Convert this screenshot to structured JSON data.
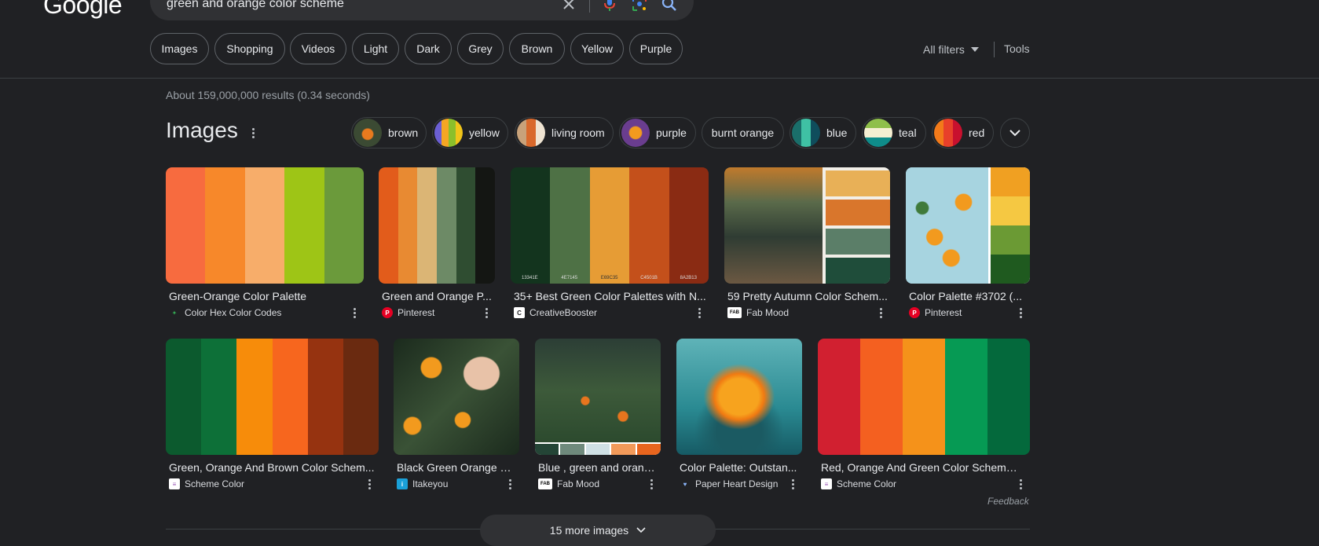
{
  "header": {
    "logo": "Google",
    "search_query": "green and orange color scheme"
  },
  "chips": [
    "Images",
    "Shopping",
    "Videos",
    "Light",
    "Dark",
    "Grey",
    "Brown",
    "Yellow",
    "Purple"
  ],
  "filters": {
    "all_filters": "All filters",
    "tools": "Tools"
  },
  "result_stats": "About 159,000,000 results (0.34 seconds)",
  "images_section": {
    "title": "Images",
    "refinements": [
      {
        "label": "brown"
      },
      {
        "label": "yellow"
      },
      {
        "label": "living room"
      },
      {
        "label": "purple"
      },
      {
        "label": "burnt orange"
      },
      {
        "label": "blue"
      },
      {
        "label": "teal"
      },
      {
        "label": "red"
      }
    ],
    "row1": [
      {
        "title": "Green-Orange Color Palette",
        "source": "Color Hex Color Codes"
      },
      {
        "title": "Green and Orange P...",
        "source": "Pinterest"
      },
      {
        "title": "35+ Best Green Color Palettes with N...",
        "source": "CreativeBooster",
        "codes": [
          "13341E",
          "4E7145",
          "E69C35",
          "C4501B",
          "8A2B13"
        ]
      },
      {
        "title": "59 Pretty Autumn Color Schem...",
        "source": "Fab Mood"
      },
      {
        "title": "Color Palette #3702 (...",
        "source": "Pinterest"
      }
    ],
    "row2": [
      {
        "title": "Green, Orange And Brown Color Schem...",
        "source": "Scheme Color"
      },
      {
        "title": "Black Green Orange a...",
        "source": "Itakeyou"
      },
      {
        "title": "Blue , green and orang...",
        "source": "Fab Mood"
      },
      {
        "title": "Color Palette: Outstan...",
        "source": "Paper Heart Design"
      },
      {
        "title": "Red, Orange And Green Color Scheme ...",
        "source": "Scheme Color"
      }
    ],
    "feedback": "Feedback",
    "more_images": "15 more images"
  },
  "colors": {
    "background": "#202124",
    "surface": "#303134",
    "border": "#5f6368",
    "text": "#e8eaed",
    "muted": "#9aa0a6",
    "pinterest": "#e60023"
  }
}
